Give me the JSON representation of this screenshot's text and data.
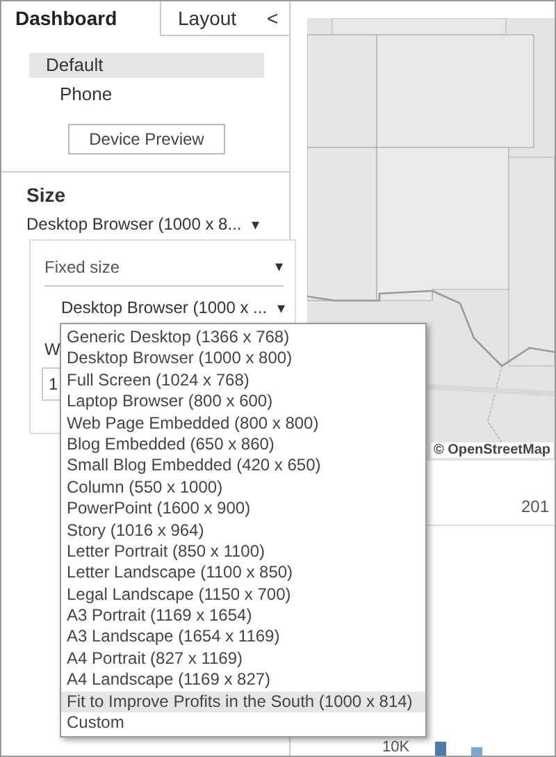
{
  "tabs": [
    {
      "label": "Dashboard",
      "selected": true
    },
    {
      "label": "Layout",
      "selected": false
    }
  ],
  "collapse_button": {
    "label": "<"
  },
  "devices": [
    {
      "label": "Default",
      "selected": true,
      "indent": false
    },
    {
      "label": "Phone",
      "selected": false,
      "indent": true
    }
  ],
  "device_preview_button": "Device Preview",
  "size": {
    "heading": "Size",
    "value": "Desktop Browser (1000 x 8...",
    "caret": "▾"
  },
  "size_popup": {
    "mode": "Fixed size",
    "mode_caret": "▾",
    "preset": "Desktop Browser (1000 x ...",
    "preset_caret": "▾",
    "width_label": "W",
    "width_value": "1"
  },
  "preset_menu": [
    {
      "label": "Generic Desktop (1366 x 768)",
      "selected": false
    },
    {
      "label": "Desktop Browser (1000 x 800)",
      "selected": false
    },
    {
      "label": "Full Screen (1024 x 768)",
      "selected": false
    },
    {
      "label": "Laptop Browser (800 x 600)",
      "selected": false
    },
    {
      "label": "Web Page Embedded (800 x 800)",
      "selected": false
    },
    {
      "label": "Blog Embedded (650 x 860)",
      "selected": false
    },
    {
      "label": "Small Blog Embedded (420 x 650)",
      "selected": false
    },
    {
      "label": "Column (550 x 1000)",
      "selected": false
    },
    {
      "label": "PowerPoint (1600 x 900)",
      "selected": false
    },
    {
      "label": "Story (1016 x 964)",
      "selected": false
    },
    {
      "label": "Letter Portrait (850 x 1100)",
      "selected": false
    },
    {
      "label": "Letter Landscape (1100 x 850)",
      "selected": false
    },
    {
      "label": "Legal Landscape (1150 x 700)",
      "selected": false
    },
    {
      "label": "A3 Portrait (1169 x 1654)",
      "selected": false
    },
    {
      "label": "A3 Landscape (1654 x 1169)",
      "selected": false
    },
    {
      "label": "A4 Portrait (827 x 1169)",
      "selected": false
    },
    {
      "label": "A4 Landscape (1169 x 827)",
      "selected": false
    },
    {
      "label": "Fit to Improve Profits in the South (1000 x 814)",
      "selected": true
    },
    {
      "label": "Custom",
      "selected": false
    }
  ],
  "map": {
    "kind": "picture",
    "attribution": "© OpenStreetMap"
  },
  "chart": {
    "column_header": "201",
    "axis_label": "10K"
  }
}
